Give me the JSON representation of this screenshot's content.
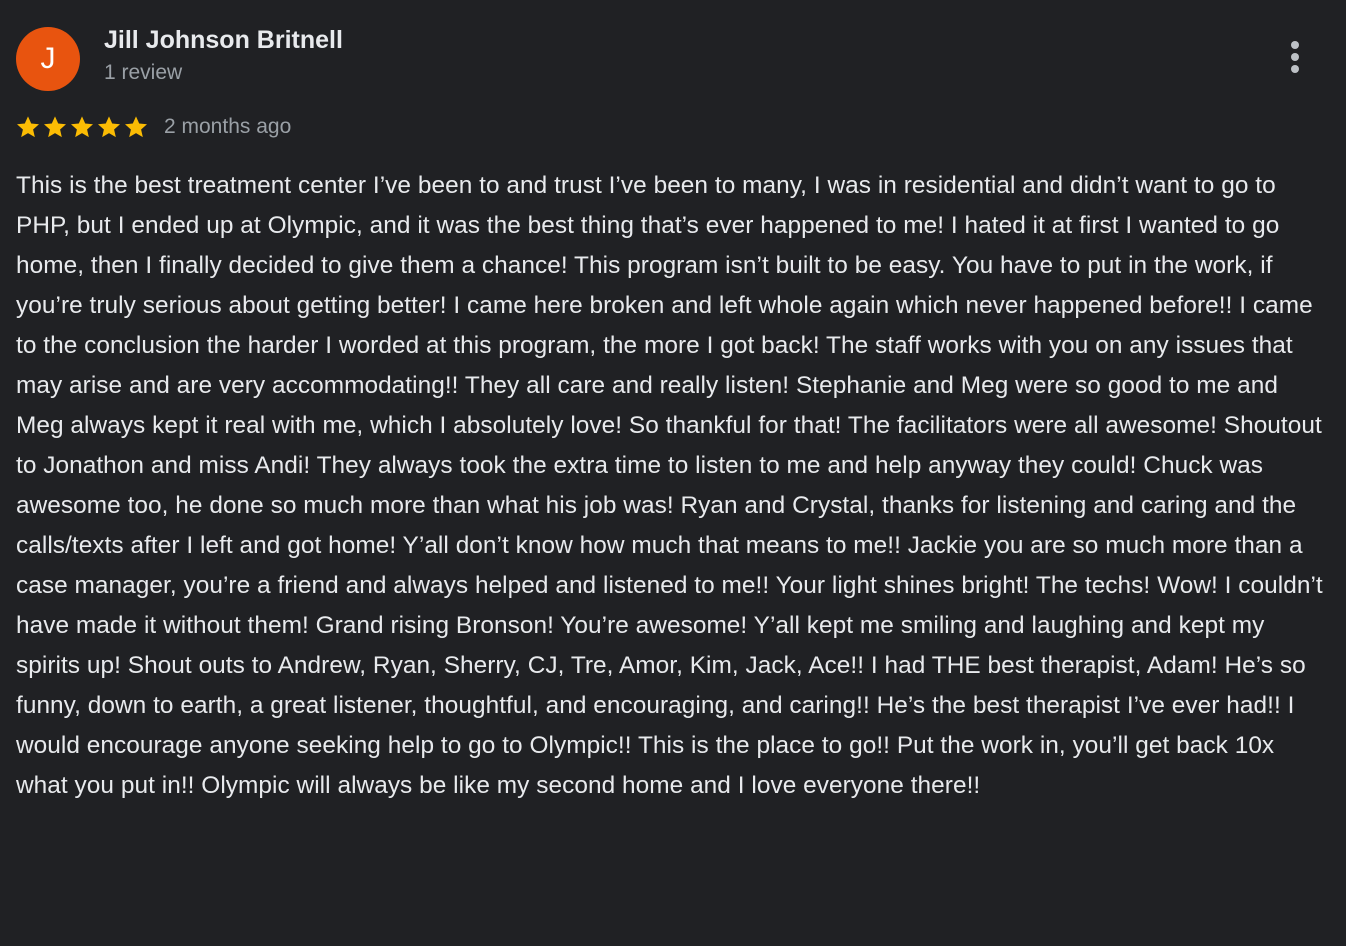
{
  "review": {
    "avatar_letter": "J",
    "avatar_color": "#e8540f",
    "author_name": "Jill Johnson Britnell",
    "author_meta": "1 review",
    "rating": 5,
    "rating_max": 5,
    "star_color": "#fbbc04",
    "date": "2 months ago",
    "more_icon": "more-vert-icon",
    "text": "This is the best treatment center I’ve been to and trust I’ve been to many, I was in residential and didn’t want to go to PHP, but I ended up at Olympic, and it was the best thing that’s ever happened to me! I hated it at first I wanted to go home, then I finally decided to give them a chance! This program isn’t built to be easy. You have to put in the work, if you’re truly serious about getting better! I came here broken and left whole again which never happened before!! I came to the conclusion the harder I worded at this program, the more I got back! The staff works with you on any issues that may arise and are very accommodating!! They all care and really listen! Stephanie and Meg were so good to me and Meg always kept it real with me, which I absolutely love! So thankful for that! The facilitators were all awesome! Shoutout to Jonathon and miss Andi! They always took the extra time to listen to me and help anyway they could! Chuck was awesome too, he done so much more than what his job was! Ryan and Crystal, thanks for listening and caring and the calls/texts after I left and got home! Y’all don’t know how much that means to me!! Jackie you are so much more than a case manager, you’re a friend and always helped and listened to me!! Your light shines bright! The techs! Wow! I couldn’t have made it without them! Grand rising Bronson! You’re awesome! Y’all kept me smiling and laughing and kept my spirits up! Shout outs to Andrew, Ryan, Sherry, CJ, Tre, Amor, Kim, Jack, Ace!! I had THE best therapist, Adam! He’s so funny, down to earth, a great listener, thoughtful, and encouraging, and caring!! He’s the best therapist I’ve ever had!! I would encourage anyone seeking help to go to Olympic!! This is the place to go!! Put the work in, you’ll get back 10x what you put in!! Olympic will always be like my second home and I love everyone there!!"
  }
}
